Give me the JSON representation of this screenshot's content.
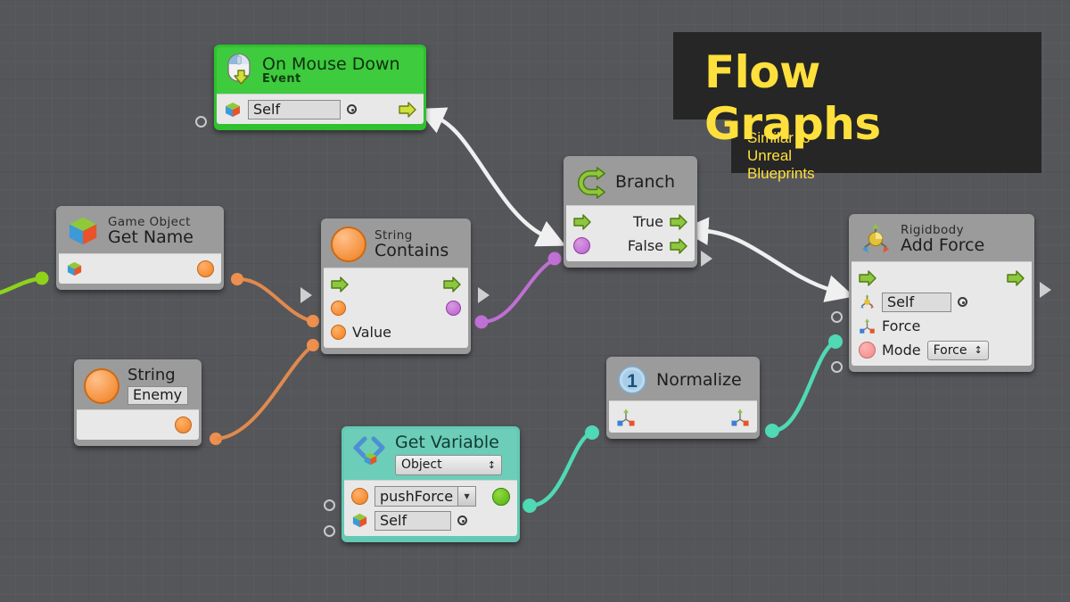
{
  "canvas": {
    "background_color": "#55565a",
    "grid": "on"
  },
  "overlay": {
    "title": "Flow Graphs",
    "subtitle": "Similar to Unreal Blueprints",
    "title_color": "#ffe03c",
    "panel_color": "#262626"
  },
  "nodes": {
    "on_mouse_down": {
      "title": "On Mouse Down",
      "subtitle": "Event",
      "icon": "mouse-down-icon",
      "color": "#3ecb3e",
      "target_value": "Self",
      "target_icon": "cube-icon",
      "output_flow_icon": "flow-arrow-icon"
    },
    "get_name": {
      "subtitle": "Game Object",
      "title": "Get Name",
      "icon": "cube-icon",
      "input_icon": "cube-icon",
      "output_port": "string-port"
    },
    "string_literal": {
      "title": "String",
      "icon": "string-circle-icon",
      "value": "Enemy",
      "output_port": "string-port"
    },
    "string_contains": {
      "subtitle": "String",
      "title": "Contains",
      "icon": "string-circle-icon",
      "in_flow": "flow-arrow-icon",
      "out_flow": "flow-arrow-icon",
      "in_a_label": "",
      "in_b_label": "Value",
      "out_port": "bool-port"
    },
    "branch": {
      "title": "Branch",
      "icon": "branch-icon",
      "in_flow": "flow-arrow-icon",
      "condition_port": "bool-port",
      "true_label": "True",
      "false_label": "False"
    },
    "get_variable": {
      "title": "Get Variable",
      "icon": "code-brackets-icon",
      "kind_value": "Object",
      "name_value": "pushForce",
      "target_value": "Self",
      "target_icon": "cube-icon",
      "output_port": "object-port"
    },
    "normalize": {
      "title": "Normalize",
      "icon": "number-one-icon",
      "in_icon": "vector3-icon",
      "out_icon": "vector3-icon"
    },
    "add_force": {
      "subtitle": "Rigidbody",
      "title": "Add Force",
      "icon": "rigidbody-icon",
      "in_flow": "flow-arrow-icon",
      "out_flow": "flow-arrow-icon",
      "target_value": "Self",
      "target_icon": "rigidbody-icon",
      "force_label": "Force",
      "force_icon": "vector3-icon",
      "mode_label": "Mode",
      "mode_value": "Force"
    }
  },
  "wires": {
    "flow_color": "#f0f0f0",
    "string_color": "#e08a4e",
    "bool_color": "#c06fd4",
    "object_color": "#4fd9b5",
    "gameobject_color": "#8ed21c"
  }
}
